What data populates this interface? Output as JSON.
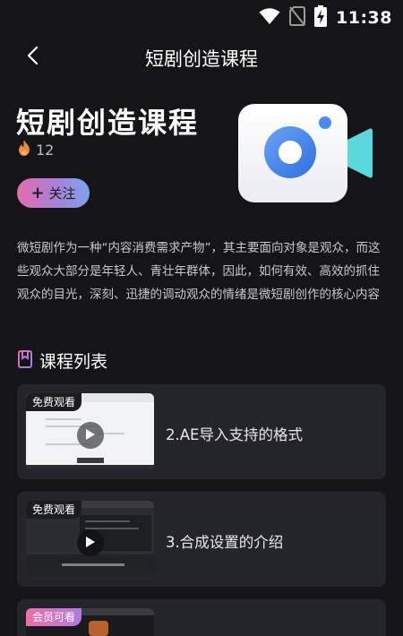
{
  "status_bar": {
    "time": "11:38",
    "icons": [
      "wifi-icon",
      "no-sim-icon",
      "battery-charging-icon"
    ]
  },
  "nav": {
    "back_icon": "chevron-left-icon",
    "title": "短剧创造课程"
  },
  "course": {
    "title": "短剧创造课程",
    "hot_icon": "flame-icon",
    "hot_count": "12",
    "follow_label": "关注",
    "follow_icon": "plus-icon",
    "hero_icon": "video-camera-icon",
    "description": "微短剧作为一种“内容消费需求产物”，其主要面向对象是观众，而这些观众大部分是年轻人、青壮年群体，因此，如何有效、高效的抓住观众的目光，深刻、迅捷的调动观众的情绪是微短剧创作的核心内容"
  },
  "list": {
    "section_icon": "bookmark-icon",
    "section_title": "课程列表",
    "items": [
      {
        "badge": "免费观看",
        "label": "2.AE导入支持的格式"
      },
      {
        "badge": "免费观看",
        "label": "3.合成设置的介绍"
      },
      {
        "badge": "会员可看",
        "label": ""
      }
    ]
  },
  "colors": {
    "background": "#151518",
    "card": "#24252b",
    "accent_blue": "#3d7bea",
    "accent_cyan": "#5ad8de",
    "follow_gradient_start": "#e66bb0",
    "follow_gradient_end": "#7ca3ee",
    "flame": "#f08a3c"
  }
}
